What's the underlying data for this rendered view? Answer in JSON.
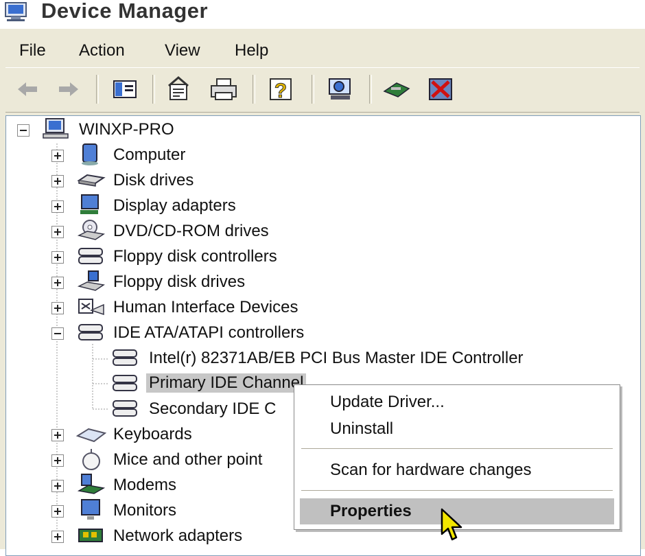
{
  "window": {
    "title": "Device Manager"
  },
  "menu": [
    "File",
    "Action",
    "View",
    "Help"
  ],
  "toolbar": {
    "buttons": [
      "back-icon",
      "forward-icon",
      "show-hide-console-tree-icon",
      "properties-icon",
      "print-icon",
      "help-icon",
      "scan-hardware-icon",
      "update-driver-icon",
      "uninstall-icon"
    ]
  },
  "tree": {
    "root": "WINXP-PRO",
    "categories": [
      "Computer",
      "Disk drives",
      "Display adapters",
      "DVD/CD-ROM drives",
      "Floppy disk controllers",
      "Floppy disk drives",
      "Human Interface Devices",
      "IDE ATA/ATAPI controllers",
      "Keyboards",
      "Mice and other point",
      "Modems",
      "Monitors",
      "Network adapters"
    ],
    "ide_children": [
      "Intel(r) 82371AB/EB PCI Bus Master IDE Controller",
      "Primary IDE Channel",
      "Secondary IDE C"
    ]
  },
  "context_menu": {
    "items": [
      "Update Driver...",
      "Uninstall",
      "Scan for hardware changes",
      "Properties"
    ],
    "highlighted": "Properties"
  }
}
